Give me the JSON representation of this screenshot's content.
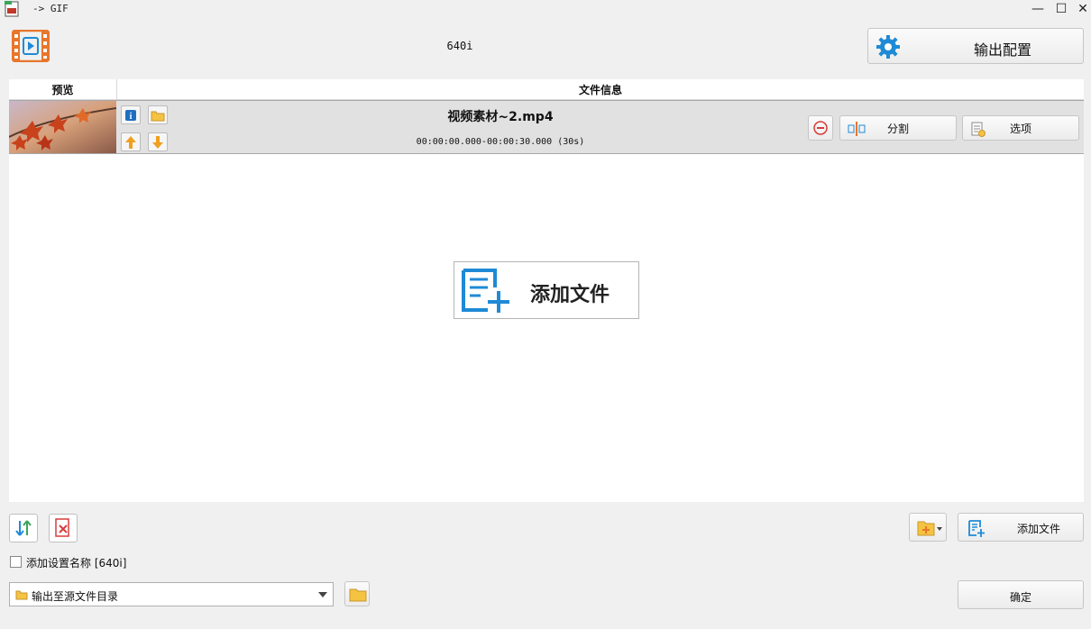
{
  "window": {
    "title": "-> GIF",
    "minimize": "—",
    "maximize": "☐",
    "close": "✕"
  },
  "header": {
    "profile_label": "640i",
    "output_config_label": "输出配置"
  },
  "table": {
    "col_preview": "预览",
    "col_info": "文件信息"
  },
  "file_row": {
    "name": "视频素材~2.mp4",
    "time_range": "00:00:00.000-00:00:30.000 (30s)",
    "split_label": "分割",
    "options_label": "选项"
  },
  "main": {
    "add_file_big": "添加文件"
  },
  "bottom": {
    "add_profile_name_label": "添加设置名称 [640i]",
    "add_profile_name_checked": false,
    "output_dir_value": "输出至源文件目录",
    "add_file_label": "添加文件",
    "ok_label": "确定"
  },
  "colors": {
    "accent_blue": "#1f8ad6",
    "orange": "#e8762b",
    "red": "#d83b3b",
    "folder_yellow": "#f5c342"
  }
}
